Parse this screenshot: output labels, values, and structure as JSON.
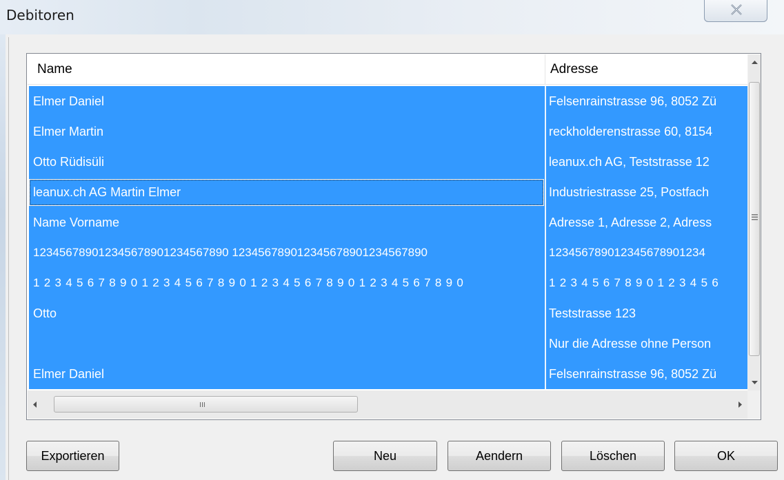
{
  "window": {
    "title": "Debitoren"
  },
  "list": {
    "columns": [
      "Name",
      "Adresse"
    ],
    "rows": [
      {
        "name": "Elmer Daniel",
        "address": "Felsenrainstrasse 96, 8052 Zü"
      },
      {
        "name": "Elmer Martin",
        "address": "reckholderenstrasse 60, 8154"
      },
      {
        "name": "Otto Rüdisüli",
        "address": "leanux.ch AG, Teststrasse 12"
      },
      {
        "name": "leanux.ch AG Martin Elmer",
        "address": "Industriestrasse 25, Postfach"
      },
      {
        "name": "Name Vorname",
        "address": "Adresse 1, Adresse 2, Adress"
      },
      {
        "name": "123456789012345678901234567890 123456789012345678901234567890",
        "address": "123456789012345678901234"
      },
      {
        "name": "1234567890123456789012345678901234567890",
        "address": "1234567890123456"
      },
      {
        "name": "Otto",
        "address": "Teststrasse 123"
      },
      {
        "name": "",
        "address": "Nur die Adresse ohne Person"
      },
      {
        "name": "Elmer Daniel",
        "address": "Felsenrainstrasse 96, 8052 Zü"
      }
    ],
    "scroll_h_grip": "III"
  },
  "buttons": {
    "export": "Exportieren",
    "new": "Neu",
    "edit": "Aendern",
    "delete": "Löschen",
    "ok": "OK"
  },
  "colors": {
    "selection": "#3399ff",
    "selection_text": "#ffffff",
    "window_bg": "#f0f0f0"
  }
}
